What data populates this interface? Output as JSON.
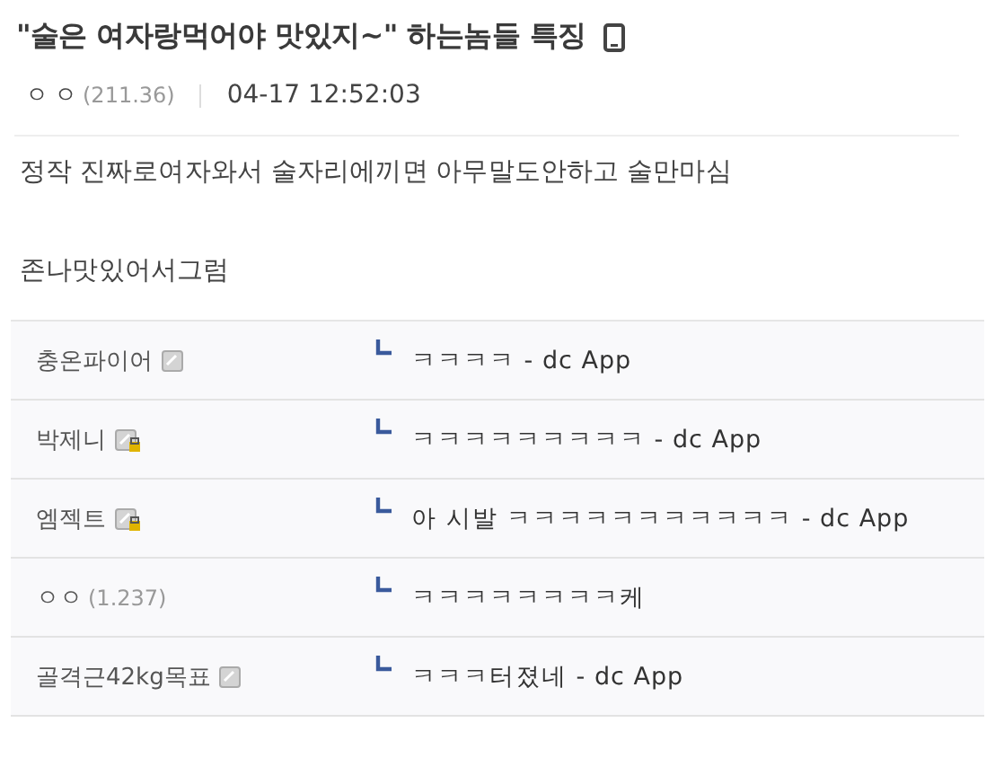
{
  "post": {
    "title": "\"술은 여자랑먹어야 맛있지~\" 하는놈들 특징",
    "mobile": true,
    "author": "ㅇㅇ",
    "ip": "(211.36)",
    "date": "04-17 12:52:03",
    "body": [
      "정작 진짜로여자와서 술자리에끼면 아무말도안하고 술만마심",
      "존나맛있어서그럼"
    ]
  },
  "comments": [
    {
      "kind": "member",
      "nickname": "충온파이어",
      "text": "ㅋㅋㅋㅋ - dc App"
    },
    {
      "kind": "locked",
      "nickname": "박제니",
      "text": "ㅋㅋㅋㅋㅋㅋㅋㅋㅋ - dc App"
    },
    {
      "kind": "locked",
      "nickname": "엠젝트",
      "text": "아 시발 ㅋㅋㅋㅋㅋㅋㅋㅋㅋㅋㅋ - dc App"
    },
    {
      "kind": "guest",
      "nickname": "ㅇㅇ",
      "ip": "(1.237)",
      "text": "ㅋㅋㅋㅋㅋㅋㅋㅋ케"
    },
    {
      "kind": "member",
      "nickname": "골격근42kg목표",
      "text": "ㅋㅋㅋ터졌네 - dc App"
    }
  ]
}
